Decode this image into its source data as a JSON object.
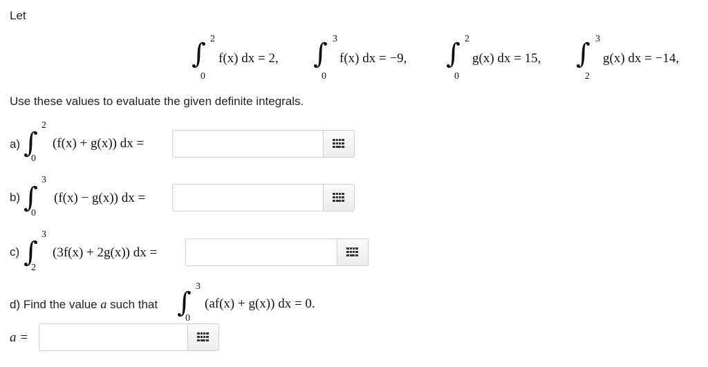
{
  "intro": {
    "let_text": "Let",
    "instruction": "Use these values to evaluate the given definite integrals."
  },
  "given": [
    {
      "lower": "0",
      "upper": "2",
      "integrand": "f(x) dx = 2,"
    },
    {
      "lower": "0",
      "upper": "3",
      "integrand": "f(x) dx = −9,"
    },
    {
      "lower": "0",
      "upper": "2",
      "integrand": "g(x) dx = 15,"
    },
    {
      "lower": "2",
      "upper": "3",
      "integrand": "g(x) dx = −14,"
    }
  ],
  "parts": [
    {
      "label": "a)",
      "lower": "0",
      "upper": "2",
      "expr": "(f(x) + g(x)) dx =",
      "value": ""
    },
    {
      "label": "b)",
      "lower": "0",
      "upper": "3",
      "expr": "(f(x) − g(x)) dx =",
      "value": ""
    },
    {
      "label": "c)",
      "lower": "2",
      "upper": "3",
      "expr": "(3f(x) + 2g(x)) dx =",
      "value": ""
    }
  ],
  "part_d": {
    "prompt_start": "d) Find the value",
    "variable": "a",
    "prompt_end": "such that",
    "lower": "0",
    "upper": "3",
    "expr": "(af(x) + g(x)) dx = 0.",
    "answer_label": "a =",
    "value": ""
  },
  "icons": {
    "keyboard_button": "math-keyboard-grid-icon"
  }
}
